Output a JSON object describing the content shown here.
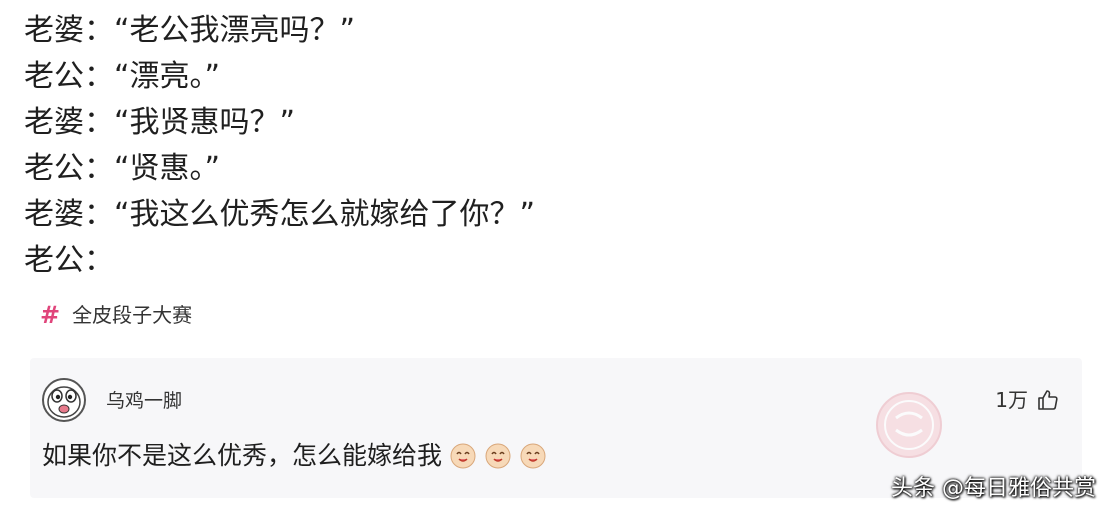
{
  "dialogue": [
    "老婆：“老公我漂亮吗？”",
    "老公：“漂亮。”",
    "老婆：“我贤惠吗？”",
    "老公：“贤惠。”",
    "老婆：“我这么优秀怎么就嫁给了你？”",
    "老公："
  ],
  "topic": {
    "icon": "hashtag-icon",
    "label": "全皮段子大赛",
    "color": "#e0457b"
  },
  "comment": {
    "username": "乌鸡一脚",
    "avatar_icon": "cartoon-face-avatar",
    "likes": "1万",
    "like_icon": "thumbs-up-icon",
    "text": "如果你不是这么优秀，怎么能嫁给我",
    "emojis": [
      "smile-emoji",
      "smile-emoji",
      "smile-emoji"
    ]
  },
  "watermark": "头条 @每日雅俗共赏"
}
